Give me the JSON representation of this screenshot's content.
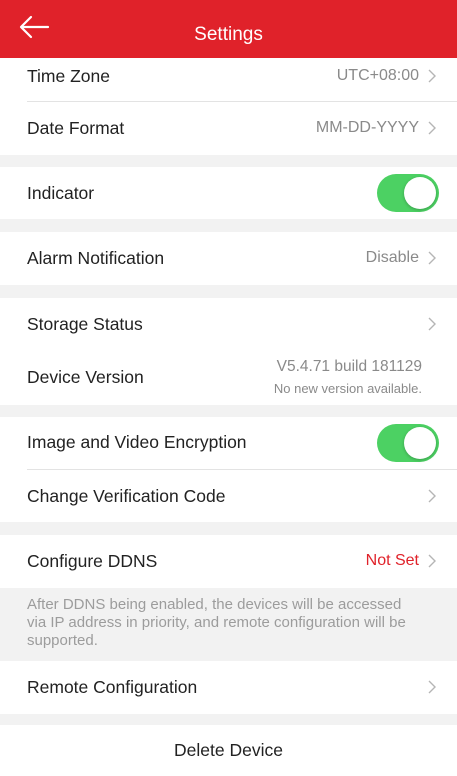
{
  "header": {
    "back_icon": "arrow-left-icon",
    "title": "Settings"
  },
  "rows": {
    "time_zone": {
      "label": "Time Zone",
      "value": "UTC+08:00"
    },
    "date_format": {
      "label": "Date Format",
      "value": "MM-DD-YYYY"
    },
    "indicator": {
      "label": "Indicator",
      "enabled": true
    },
    "alarm_notification": {
      "label": "Alarm Notification",
      "value": "Disable"
    },
    "storage_status": {
      "label": "Storage Status"
    },
    "device_version": {
      "label": "Device Version",
      "version": "V5.4.71 build 181129",
      "status": "No new version available."
    },
    "encryption": {
      "label": "Image and Video Encryption",
      "enabled": true
    },
    "change_code": {
      "label": "Change Verification Code"
    },
    "ddns": {
      "label": "Configure DDNS",
      "value": "Not Set"
    },
    "ddns_note": "After DDNS being enabled, the devices will be accessed via IP address in priority, and remote configuration will be supported.",
    "remote_config": {
      "label": "Remote Configuration"
    }
  },
  "delete_label": "Delete Device",
  "colors": {
    "header_red": "#e0222a",
    "toggle_green": "#4cd163",
    "not_set_red": "#e0222a",
    "group_background": "#f2f2f2"
  }
}
